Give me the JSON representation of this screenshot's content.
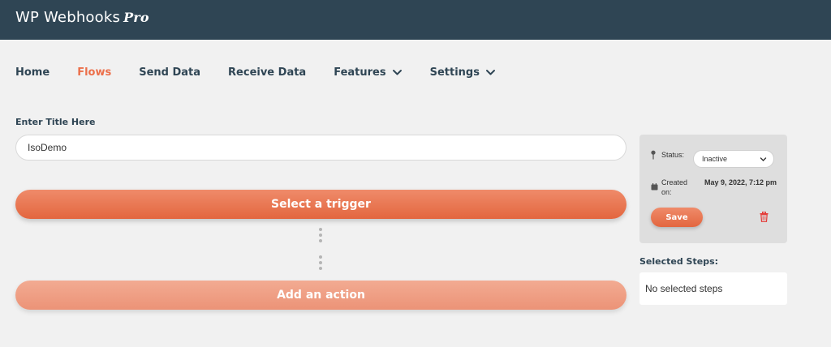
{
  "header": {
    "brand": "WP Webhooks",
    "brand_pro": "Pro"
  },
  "nav": {
    "items": [
      {
        "label": "Home"
      },
      {
        "label": "Flows",
        "active": true
      },
      {
        "label": "Send Data"
      },
      {
        "label": "Receive Data"
      },
      {
        "label": "Features",
        "has_dropdown": true
      },
      {
        "label": "Settings",
        "has_dropdown": true
      }
    ]
  },
  "flow": {
    "title_label": "Enter Title Here",
    "title_value": "IsoDemo",
    "trigger_button": "Select a trigger",
    "action_button": "Add an action"
  },
  "sidebar": {
    "status_label": "Status:",
    "status_value": "Inactive",
    "created_label": "Created on:",
    "created_value": "May 9, 2022, 7:12 pm",
    "save_button": "Save",
    "selected_steps_label": "Selected Steps:",
    "selected_steps_empty": "No selected steps"
  },
  "colors": {
    "header_bg": "#2f4554",
    "accent": "#ec6f4a",
    "delete": "#e53935"
  },
  "icons": [
    "chevron-down-icon",
    "pin-icon",
    "calendar-icon",
    "trash-icon"
  ]
}
